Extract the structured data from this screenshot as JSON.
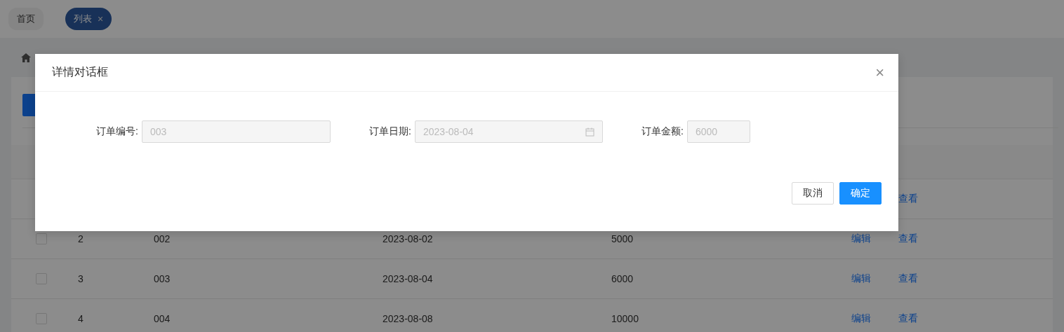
{
  "tabs": [
    {
      "label": "首页",
      "selected": false
    },
    {
      "label": "列表",
      "close": "×",
      "selected": true
    }
  ],
  "table": {
    "rows": [
      {
        "view": "查看"
      },
      {
        "checked": false,
        "index": "2",
        "order_no": "002",
        "date": "2023-08-02",
        "amount": "5000",
        "edit": "编辑",
        "view": "查看"
      },
      {
        "checked": false,
        "index": "3",
        "order_no": "003",
        "date": "2023-08-04",
        "amount": "6000",
        "edit": "编辑",
        "view": "查看"
      },
      {
        "checked": false,
        "index": "4",
        "order_no": "004",
        "date": "2023-08-08",
        "amount": "10000",
        "edit": "编辑",
        "view": "查看"
      }
    ]
  },
  "dialog": {
    "title": "详情对话框",
    "close": "×",
    "fields": [
      {
        "kind": "text",
        "label": "订单编号:",
        "value": "003",
        "disabled": true
      },
      {
        "kind": "date",
        "label": "订单日期:",
        "value": "2023-08-04",
        "disabled": true
      },
      {
        "kind": "number",
        "label": "订单金额:",
        "value": "6000",
        "disabled": true
      }
    ],
    "buttons": [
      {
        "label": "取消",
        "kind": "default"
      },
      {
        "label": "确定",
        "kind": "primary"
      }
    ]
  }
}
